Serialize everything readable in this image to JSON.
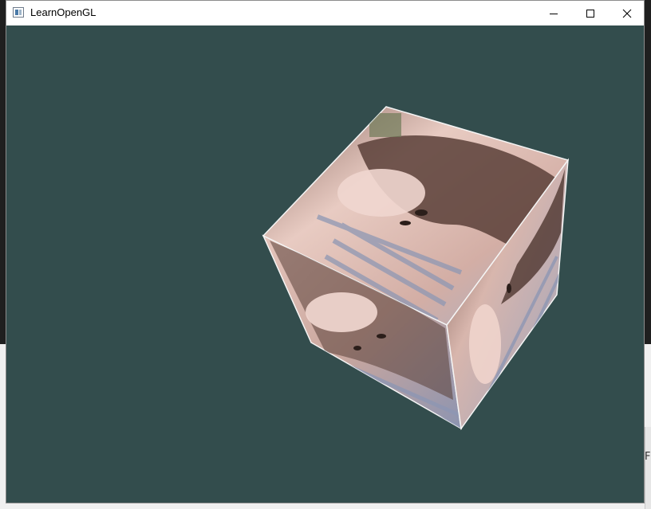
{
  "window": {
    "title": "LearnOpenGL",
    "clear_color": "#334d4d",
    "controls": {
      "minimize_icon": "minimize-icon",
      "maximize_icon": "maximize-icon",
      "close_icon": "close-icon"
    }
  },
  "scene": {
    "object": "textured-cube",
    "texture_icon": "portrait-photo-texture",
    "face_colors": {
      "top": "#d9b8b0",
      "front": "#c9a59c",
      "right": "#b7958c",
      "hair": "#5a4038",
      "stripes": "#a9b2c8"
    }
  },
  "desktop": {
    "edge_glyph": "F"
  }
}
